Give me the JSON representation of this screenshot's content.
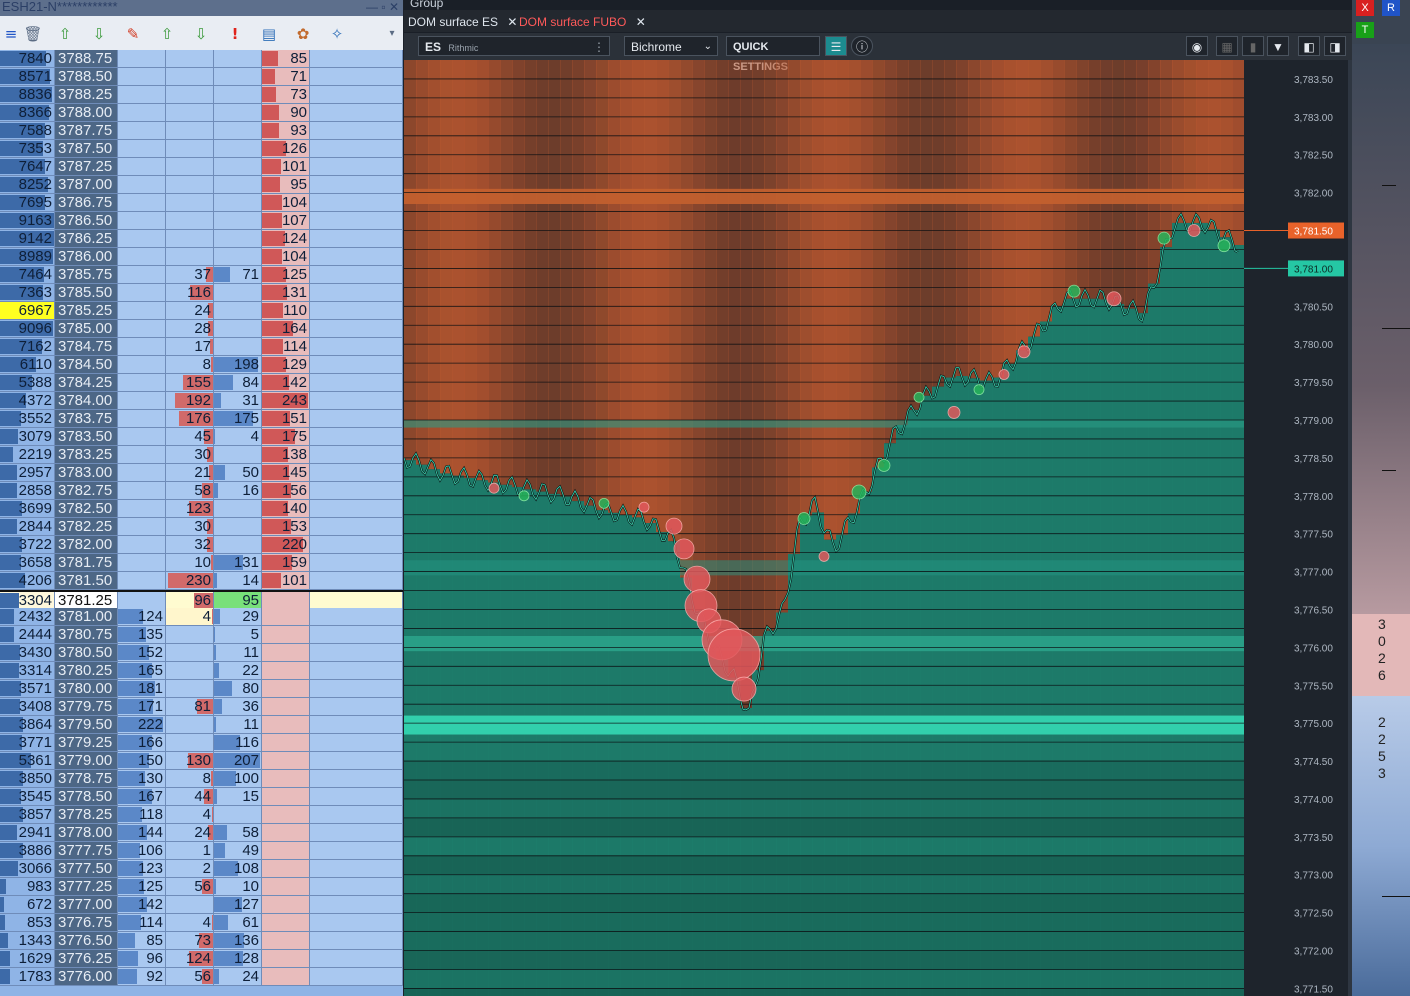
{
  "ladder": {
    "window_title": "ESH21-N************",
    "toolbar_icons": [
      "ladder-icon",
      "trash-icon",
      "export-icon",
      "download-icon",
      "magic-icon",
      "upload-icon",
      "download-green-icon",
      "alert-icon",
      "chart-doc-icon",
      "palette-icon",
      "wrench-icon",
      "dropdown-icon"
    ],
    "rows": [
      {
        "vol": "7840",
        "price": "3788.75",
        "bid": "",
        "sold": "",
        "bought": "",
        "ask": "85"
      },
      {
        "vol": "8571",
        "price": "3788.50",
        "bid": "",
        "sold": "",
        "bought": "",
        "ask": "71"
      },
      {
        "vol": "8836",
        "price": "3788.25",
        "bid": "",
        "sold": "",
        "bought": "",
        "ask": "73"
      },
      {
        "vol": "8366",
        "price": "3788.00",
        "bid": "",
        "sold": "",
        "bought": "",
        "ask": "90"
      },
      {
        "vol": "7588",
        "price": "3787.75",
        "bid": "",
        "sold": "",
        "bought": "",
        "ask": "93"
      },
      {
        "vol": "7353",
        "price": "3787.50",
        "bid": "",
        "sold": "",
        "bought": "",
        "ask": "126"
      },
      {
        "vol": "7647",
        "price": "3787.25",
        "bid": "",
        "sold": "",
        "bought": "",
        "ask": "101"
      },
      {
        "vol": "8252",
        "price": "3787.00",
        "bid": "",
        "sold": "",
        "bought": "",
        "ask": "95"
      },
      {
        "vol": "7695",
        "price": "3786.75",
        "bid": "",
        "sold": "",
        "bought": "",
        "ask": "104"
      },
      {
        "vol": "9163",
        "price": "3786.50",
        "bid": "",
        "sold": "",
        "bought": "",
        "ask": "107"
      },
      {
        "vol": "9142",
        "price": "3786.25",
        "bid": "",
        "sold": "",
        "bought": "",
        "ask": "124"
      },
      {
        "vol": "8989",
        "price": "3786.00",
        "bid": "",
        "sold": "",
        "bought": "",
        "ask": "104"
      },
      {
        "vol": "7464",
        "price": "3785.75",
        "bid": "",
        "sold": "37",
        "bought": "71",
        "ask": "125"
      },
      {
        "vol": "7363",
        "price": "3785.50",
        "bid": "",
        "sold": "116",
        "bought": "",
        "ask": "131"
      },
      {
        "vol": "6967",
        "price": "3785.25",
        "bid": "",
        "sold": "24",
        "bought": "",
        "ask": "110",
        "hl": true
      },
      {
        "vol": "9096",
        "price": "3785.00",
        "bid": "",
        "sold": "28",
        "bought": "",
        "ask": "164"
      },
      {
        "vol": "7162",
        "price": "3784.75",
        "bid": "",
        "sold": "17",
        "bought": "",
        "ask": "114"
      },
      {
        "vol": "6110",
        "price": "3784.50",
        "bid": "",
        "sold": "8",
        "bought": "198",
        "ask": "129"
      },
      {
        "vol": "5388",
        "price": "3784.25",
        "bid": "",
        "sold": "155",
        "bought": "84",
        "ask": "142"
      },
      {
        "vol": "4372",
        "price": "3784.00",
        "bid": "",
        "sold": "192",
        "bought": "31",
        "ask": "243"
      },
      {
        "vol": "3552",
        "price": "3783.75",
        "bid": "",
        "sold": "176",
        "bought": "175",
        "ask": "151"
      },
      {
        "vol": "3079",
        "price": "3783.50",
        "bid": "",
        "sold": "45",
        "bought": "4",
        "ask": "175"
      },
      {
        "vol": "2219",
        "price": "3783.25",
        "bid": "",
        "sold": "30",
        "bought": "",
        "ask": "138"
      },
      {
        "vol": "2957",
        "price": "3783.00",
        "bid": "",
        "sold": "21",
        "bought": "50",
        "ask": "145"
      },
      {
        "vol": "2858",
        "price": "3782.75",
        "bid": "",
        "sold": "58",
        "bought": "16",
        "ask": "156"
      },
      {
        "vol": "3699",
        "price": "3782.50",
        "bid": "",
        "sold": "123",
        "bought": "",
        "ask": "140"
      },
      {
        "vol": "2844",
        "price": "3782.25",
        "bid": "",
        "sold": "30",
        "bought": "",
        "ask": "153"
      },
      {
        "vol": "3722",
        "price": "3782.00",
        "bid": "",
        "sold": "32",
        "bought": "",
        "ask": "220"
      },
      {
        "vol": "3658",
        "price": "3781.75",
        "bid": "",
        "sold": "10",
        "bought": "131",
        "ask": "159"
      },
      {
        "vol": "4206",
        "price": "3781.50",
        "bid": "",
        "sold": "230",
        "bought": "14",
        "ask": "101"
      },
      {
        "vol": "3304",
        "price": "3781.25",
        "bid": "",
        "sold": "96",
        "bought": "95",
        "ask": "",
        "cur": true
      },
      {
        "vol": "2432",
        "price": "3781.00",
        "bid": "124",
        "sold": "4",
        "bought": "29",
        "ask": ""
      },
      {
        "vol": "2444",
        "price": "3780.75",
        "bid": "135",
        "sold": "",
        "bought": "5",
        "ask": ""
      },
      {
        "vol": "3430",
        "price": "3780.50",
        "bid": "152",
        "sold": "",
        "bought": "11",
        "ask": ""
      },
      {
        "vol": "3314",
        "price": "3780.25",
        "bid": "165",
        "sold": "",
        "bought": "22",
        "ask": ""
      },
      {
        "vol": "3571",
        "price": "3780.00",
        "bid": "181",
        "sold": "",
        "bought": "80",
        "ask": ""
      },
      {
        "vol": "3408",
        "price": "3779.75",
        "bid": "171",
        "sold": "81",
        "bought": "36",
        "ask": ""
      },
      {
        "vol": "3864",
        "price": "3779.50",
        "bid": "222",
        "sold": "",
        "bought": "11",
        "ask": ""
      },
      {
        "vol": "3771",
        "price": "3779.25",
        "bid": "166",
        "sold": "",
        "bought": "116",
        "ask": ""
      },
      {
        "vol": "5361",
        "price": "3779.00",
        "bid": "150",
        "sold": "130",
        "bought": "207",
        "ask": ""
      },
      {
        "vol": "3850",
        "price": "3778.75",
        "bid": "130",
        "sold": "8",
        "bought": "100",
        "ask": ""
      },
      {
        "vol": "3545",
        "price": "3778.50",
        "bid": "167",
        "sold": "44",
        "bought": "15",
        "ask": ""
      },
      {
        "vol": "3857",
        "price": "3778.25",
        "bid": "118",
        "sold": "4",
        "bought": "",
        "ask": ""
      },
      {
        "vol": "2941",
        "price": "3778.00",
        "bid": "144",
        "sold": "24",
        "bought": "58",
        "ask": ""
      },
      {
        "vol": "3886",
        "price": "3777.75",
        "bid": "106",
        "sold": "1",
        "bought": "49",
        "ask": ""
      },
      {
        "vol": "3066",
        "price": "3777.50",
        "bid": "123",
        "sold": "2",
        "bought": "108",
        "ask": ""
      },
      {
        "vol": "983",
        "price": "3777.25",
        "bid": "125",
        "sold": "56",
        "bought": "10",
        "ask": ""
      },
      {
        "vol": "672",
        "price": "3777.00",
        "bid": "142",
        "sold": "",
        "bought": "127",
        "ask": ""
      },
      {
        "vol": "853",
        "price": "3776.75",
        "bid": "114",
        "sold": "4",
        "bought": "61",
        "ask": ""
      },
      {
        "vol": "1343",
        "price": "3776.50",
        "bid": "85",
        "sold": "73",
        "bought": "136",
        "ask": ""
      },
      {
        "vol": "1629",
        "price": "3776.25",
        "bid": "96",
        "sold": "124",
        "bought": "128",
        "ask": ""
      },
      {
        "vol": "1783",
        "price": "3776.00",
        "bid": "92",
        "sold": "56",
        "bought": "24",
        "ask": ""
      }
    ]
  },
  "surface": {
    "group_label": "Group",
    "tabs": [
      {
        "label": "DOM surface ES",
        "active": false
      },
      {
        "label": "DOM surface FUBO",
        "active": true
      }
    ],
    "instrument": "ES",
    "connection": "Rithmic",
    "theme": "Bichrome",
    "quick_settings": "QUICK SETTINGS",
    "price_axis": [
      "3,783.50",
      "3,783.00",
      "3,782.50",
      "3,782.00",
      "3,781.50",
      "3,781.00",
      "3,780.50",
      "3,780.00",
      "3,779.50",
      "3,779.00",
      "3,778.50",
      "3,778.00",
      "3,777.50",
      "3,777.00",
      "3,776.50",
      "3,776.00",
      "3,775.50",
      "3,775.00",
      "3,774.50",
      "3,774.00",
      "3,773.50",
      "3,773.00",
      "3,772.50",
      "3,772.00",
      "3,771.50"
    ],
    "ask_tag": "3,781.50",
    "bid_tag": "3,781.00",
    "colors": {
      "ask": "#b3552f",
      "bid": "#2aa98f",
      "ask_tag": "#e8622a",
      "bid_tag": "#25c7a4"
    }
  },
  "strip": {
    "x_label": "X",
    "r_label": "R",
    "t_label": "T",
    "sell_digits": [
      "3",
      "0",
      "2",
      "6"
    ],
    "buy_digits": [
      "2",
      "2",
      "5",
      "3"
    ]
  }
}
